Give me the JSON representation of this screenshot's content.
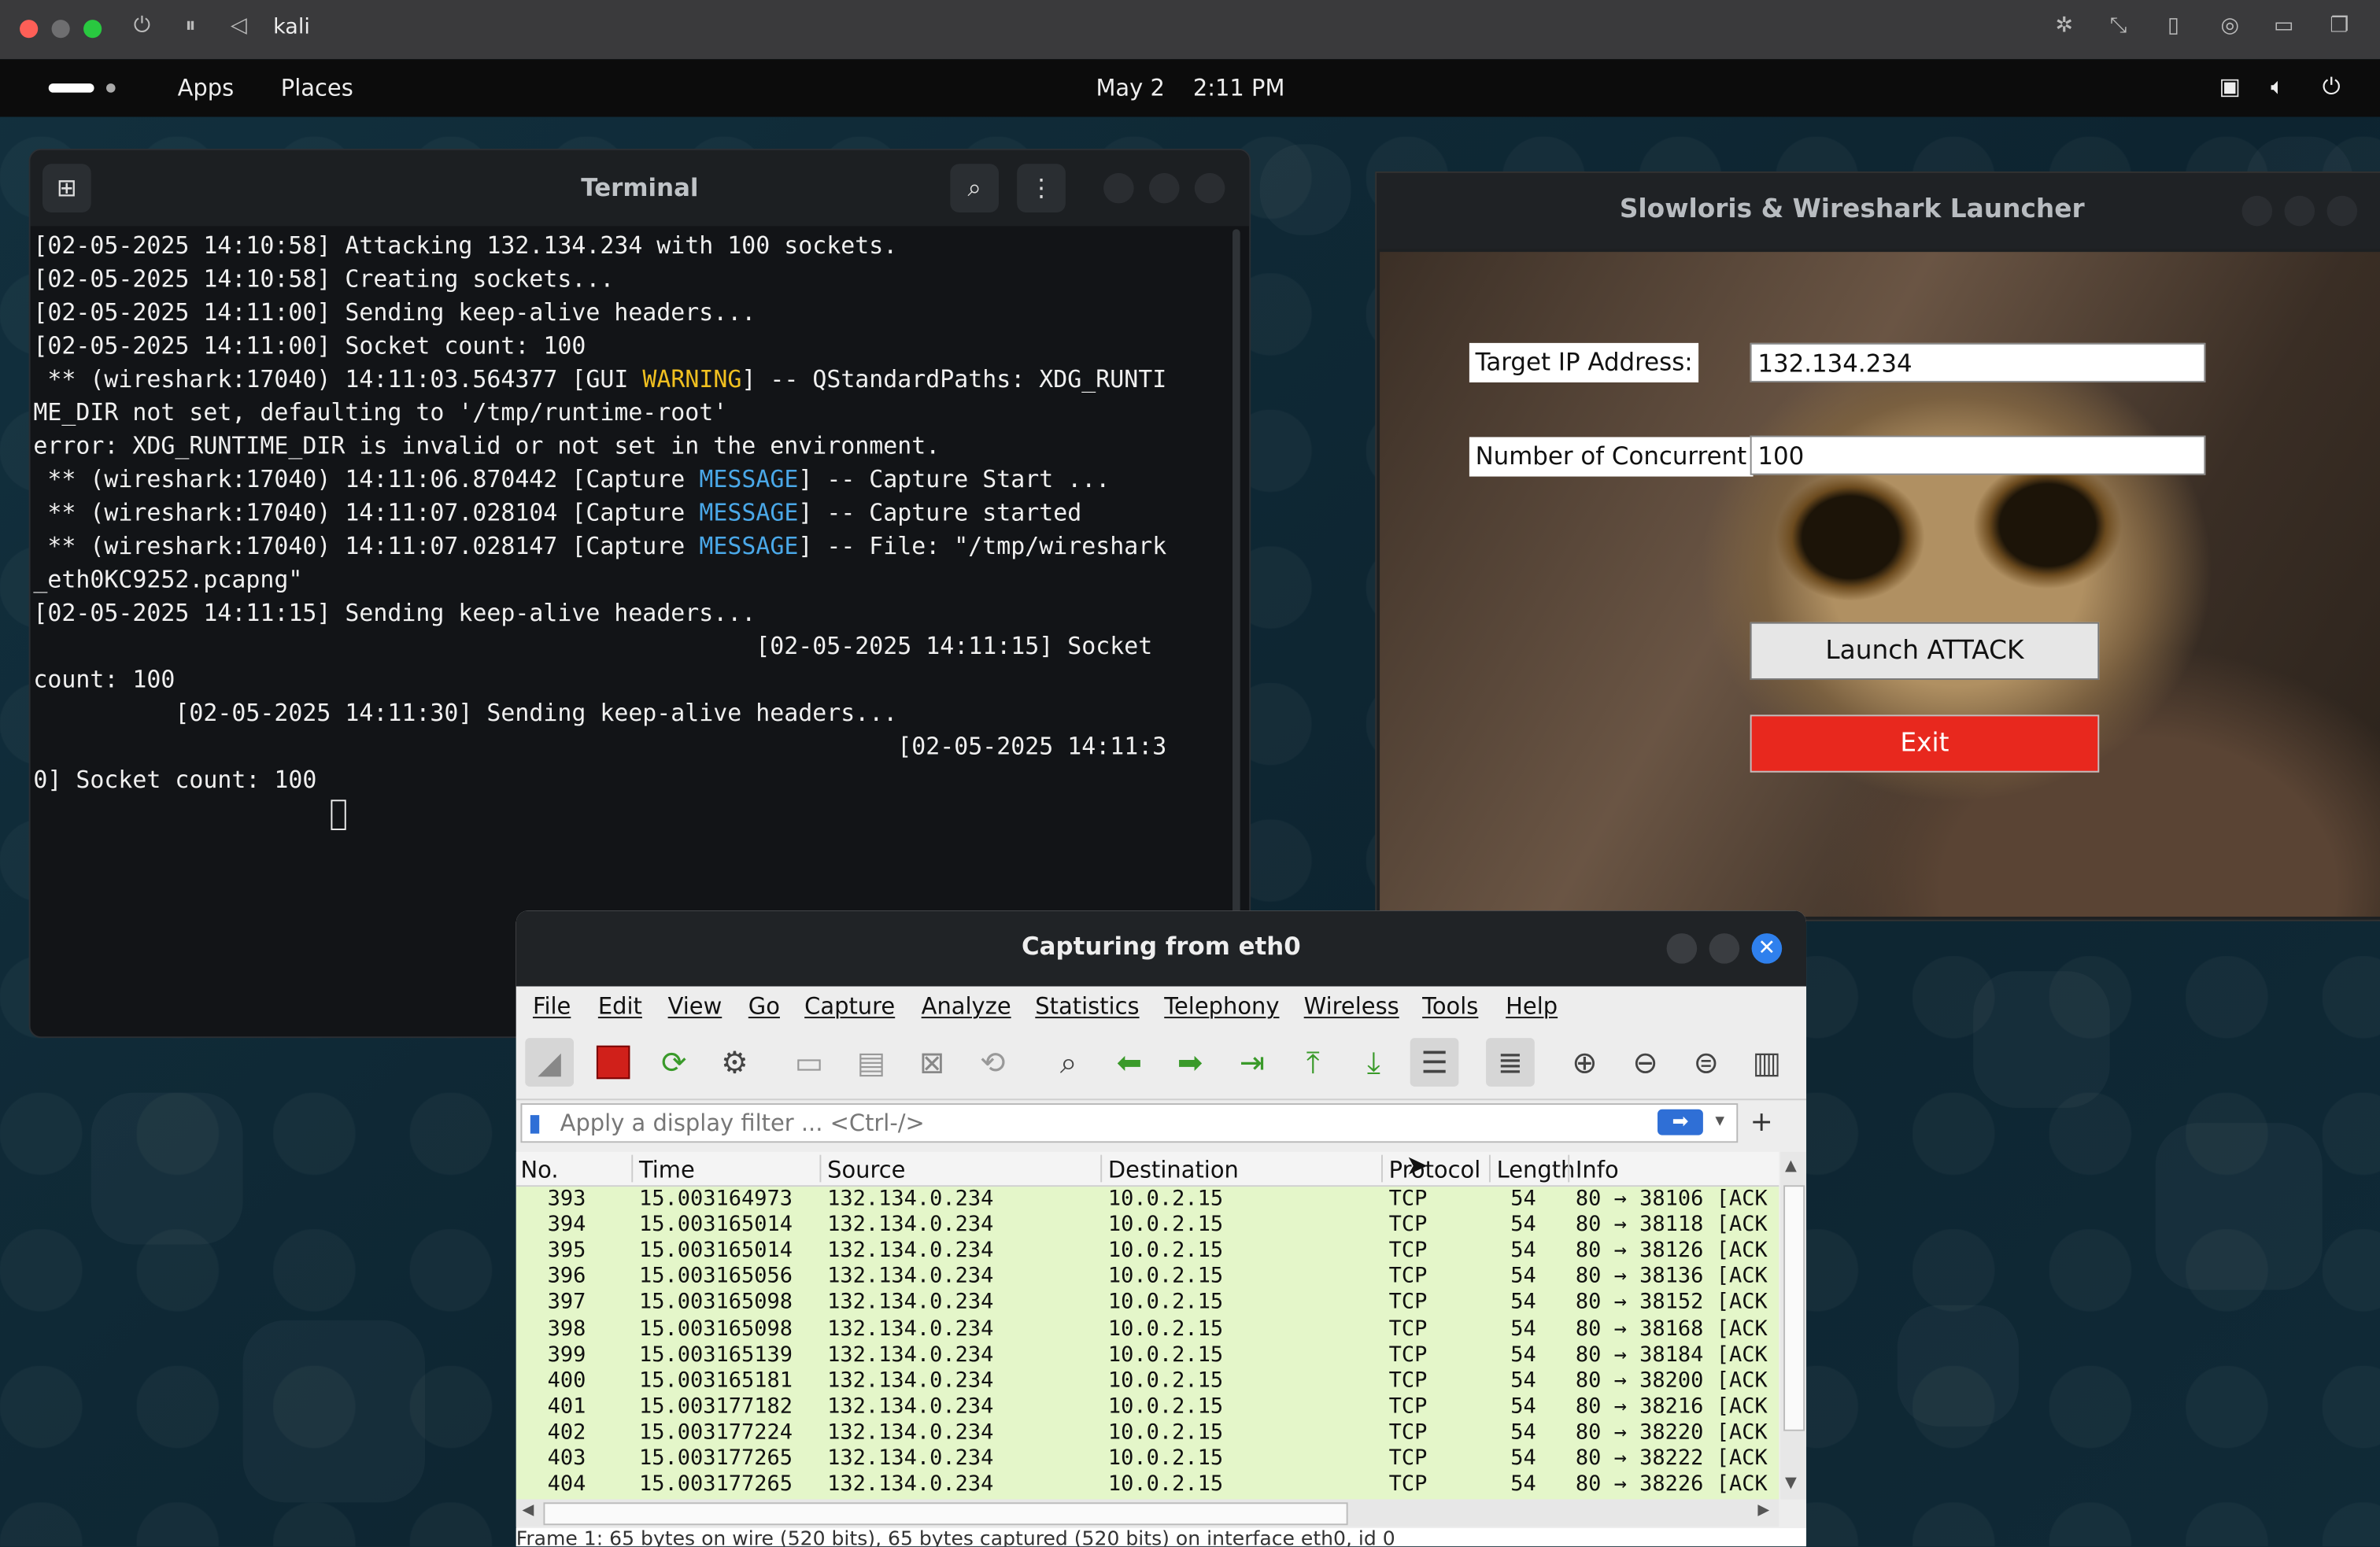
{
  "host": {
    "vm_name": "kali"
  },
  "panel": {
    "apps": "Apps",
    "places": "Places",
    "date": "May 2",
    "time": "2:11 PM"
  },
  "terminal": {
    "title": "Terminal",
    "lines": [
      [
        {
          "t": "[02-05-2025 14:10:58] Attacking 132.134.234 with 100 sockets."
        }
      ],
      [
        {
          "t": "[02-05-2025 14:10:58] Creating sockets..."
        }
      ],
      [
        {
          "t": "[02-05-2025 14:11:00] Sending keep-alive headers..."
        }
      ],
      [
        {
          "t": "[02-05-2025 14:11:00] Socket count: 100"
        }
      ],
      [
        {
          "t": " ** (wireshark:17040) 14:11:03.564377 [GUI "
        },
        {
          "t": "WARNING",
          "c": "warn"
        },
        {
          "t": "] -- QStandardPaths: XDG_RUNTI"
        }
      ],
      [
        {
          "t": "ME_DIR not set, defaulting to '/tmp/runtime-root'"
        }
      ],
      [
        {
          "t": "error: XDG_RUNTIME_DIR is invalid or not set in the environment."
        }
      ],
      [
        {
          "t": " ** (wireshark:17040) 14:11:06.870442 [Capture "
        },
        {
          "t": "MESSAGE",
          "c": "msg"
        },
        {
          "t": "] -- Capture Start ..."
        }
      ],
      [
        {
          "t": " ** (wireshark:17040) 14:11:07.028104 [Capture "
        },
        {
          "t": "MESSAGE",
          "c": "msg"
        },
        {
          "t": "] -- Capture started"
        }
      ],
      [
        {
          "t": " ** (wireshark:17040) 14:11:07.028147 [Capture "
        },
        {
          "t": "MESSAGE",
          "c": "msg"
        },
        {
          "t": "] -- File: \"/tmp/wireshark"
        }
      ],
      [
        {
          "t": "_eth0KC9252.pcapng\""
        }
      ],
      [
        {
          "t": "[02-05-2025 14:11:15] Sending keep-alive headers..."
        }
      ],
      [
        {
          "t": "                                                   [02-05-2025 14:11:15] Socket"
        }
      ],
      [
        {
          "t": "count: 100"
        }
      ],
      [
        {
          "t": "          [02-05-2025 14:11:30] Sending keep-alive headers..."
        }
      ],
      [
        {
          "t": "                                                             [02-05-2025 14:11:3"
        }
      ],
      [
        {
          "t": "0] Socket count: 100"
        }
      ]
    ]
  },
  "launcher": {
    "title": "Slowloris & Wireshark Launcher",
    "target_label": "Target IP Address:",
    "target_value": "132.134.234",
    "conc_label": "Number of Concurrent",
    "conc_value": "100",
    "launch_button": "Launch ATTACK",
    "exit_button": "Exit",
    "exit_color": "#e8281e"
  },
  "wireshark": {
    "title": "Capturing from eth0",
    "menu": [
      "File",
      "Edit",
      "View",
      "Go",
      "Capture",
      "Analyze",
      "Statistics",
      "Telephony",
      "Wireless",
      "Tools",
      "Help"
    ],
    "filter_placeholder": "Apply a display filter ... <Ctrl-/>",
    "columns": [
      "No.",
      "Time",
      "Source",
      "Destination",
      "Protocol",
      "Length",
      "Info"
    ],
    "rows": [
      [
        "393",
        "15.003164973",
        "132.134.0.234",
        "10.0.2.15",
        "TCP",
        "54",
        "80 → 38106 [ACK"
      ],
      [
        "394",
        "15.003165014",
        "132.134.0.234",
        "10.0.2.15",
        "TCP",
        "54",
        "80 → 38118 [ACK"
      ],
      [
        "395",
        "15.003165014",
        "132.134.0.234",
        "10.0.2.15",
        "TCP",
        "54",
        "80 → 38126 [ACK"
      ],
      [
        "396",
        "15.003165056",
        "132.134.0.234",
        "10.0.2.15",
        "TCP",
        "54",
        "80 → 38136 [ACK"
      ],
      [
        "397",
        "15.003165098",
        "132.134.0.234",
        "10.0.2.15",
        "TCP",
        "54",
        "80 → 38152 [ACK"
      ],
      [
        "398",
        "15.003165098",
        "132.134.0.234",
        "10.0.2.15",
        "TCP",
        "54",
        "80 → 38168 [ACK"
      ],
      [
        "399",
        "15.003165139",
        "132.134.0.234",
        "10.0.2.15",
        "TCP",
        "54",
        "80 → 38184 [ACK"
      ],
      [
        "400",
        "15.003165181",
        "132.134.0.234",
        "10.0.2.15",
        "TCP",
        "54",
        "80 → 38200 [ACK"
      ],
      [
        "401",
        "15.003177182",
        "132.134.0.234",
        "10.0.2.15",
        "TCP",
        "54",
        "80 → 38216 [ACK"
      ],
      [
        "402",
        "15.003177224",
        "132.134.0.234",
        "10.0.2.15",
        "TCP",
        "54",
        "80 → 38220 [ACK"
      ],
      [
        "403",
        "15.003177265",
        "132.134.0.234",
        "10.0.2.15",
        "TCP",
        "54",
        "80 → 38222 [ACK"
      ],
      [
        "404",
        "15.003177265",
        "132.134.0.234",
        "10.0.2.15",
        "TCP",
        "54",
        "80 → 38226 [ACK"
      ]
    ],
    "detail_line": "Frame 1: 65 bytes on wire (520 bits), 65 bytes captured (520 bits) on interface eth0, id 0",
    "row_color": "#e4f6c9"
  }
}
